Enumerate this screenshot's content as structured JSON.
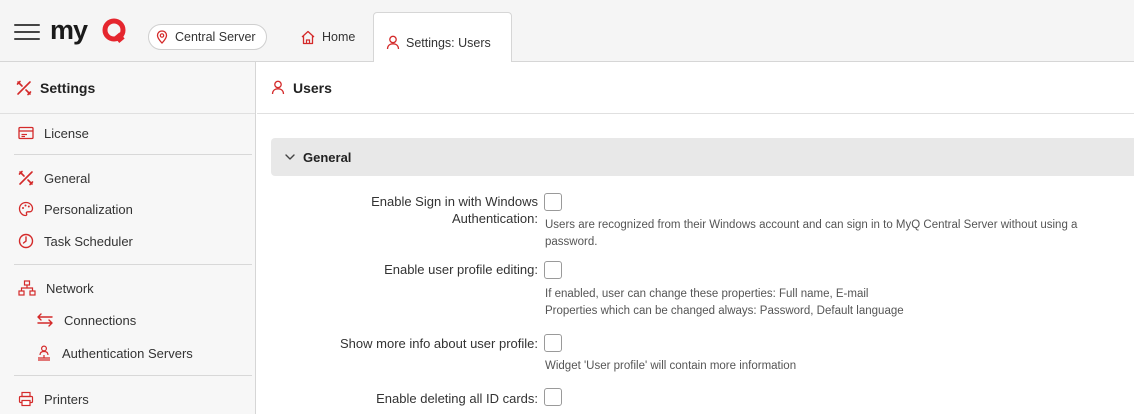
{
  "header": {
    "logo_text": "myQ",
    "server": {
      "label": "Central Server",
      "icon": "location-pin-icon"
    },
    "tabs": [
      {
        "label": "Home",
        "icon": "home-icon",
        "active": false
      },
      {
        "label": "Settings: Users",
        "icon": "user-icon",
        "active": true
      }
    ]
  },
  "sidebar": {
    "title": "Settings",
    "items": [
      {
        "label": "License",
        "icon": "license-icon"
      },
      {
        "label": "General",
        "icon": "tools-icon"
      },
      {
        "label": "Personalization",
        "icon": "palette-icon"
      },
      {
        "label": "Task Scheduler",
        "icon": "clock-icon"
      },
      {
        "label": "Network",
        "icon": "network-icon"
      },
      {
        "label": "Connections",
        "icon": "connections-icon"
      },
      {
        "label": "Authentication Servers",
        "icon": "auth-server-icon"
      },
      {
        "label": "Printers",
        "icon": "printer-icon"
      }
    ]
  },
  "main": {
    "title": "Users",
    "section": "General",
    "settings": [
      {
        "label_line1": "Enable Sign in with Windows",
        "label_line2": "Authentication:",
        "desc_line1": "Users are recognized from their Windows account and can sign in to MyQ Central Server without using a",
        "desc_line2": "password.",
        "checked": false
      },
      {
        "label_line1": "Enable user profile editing:",
        "desc_line1": "If enabled, user can change these properties: Full name, E-mail",
        "desc_line2": "Properties which can be changed always: Password, Default language",
        "checked": false
      },
      {
        "label_line1": "Show more info about user profile:",
        "desc_line1": "Widget 'User profile' will contain more information",
        "checked": false
      },
      {
        "label_line1": "Enable deleting all ID cards:",
        "checked": false
      }
    ]
  },
  "colors": {
    "brand_red": "#e5262e",
    "accent_red": "#d42a2a"
  }
}
